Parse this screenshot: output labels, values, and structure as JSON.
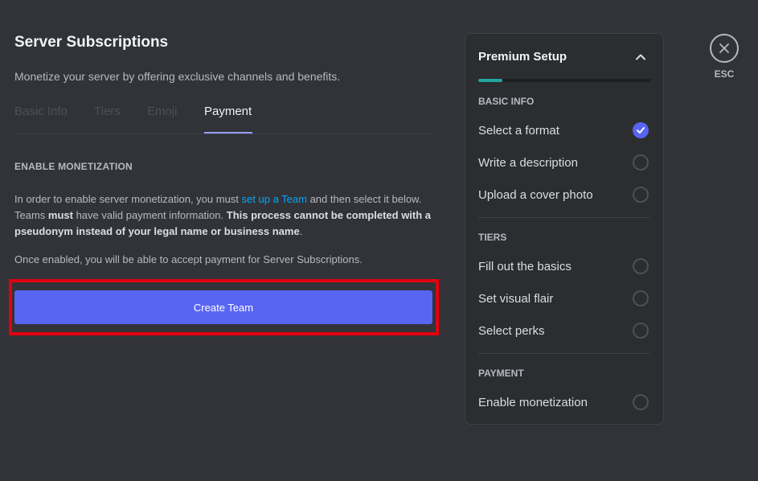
{
  "page": {
    "title": "Server Subscriptions",
    "subtitle": "Monetize your server by offering exclusive channels and benefits."
  },
  "tabs": [
    {
      "label": "Basic Info",
      "active": false
    },
    {
      "label": "Tiers",
      "active": false
    },
    {
      "label": "Emoji",
      "active": false
    },
    {
      "label": "Payment",
      "active": true
    }
  ],
  "monetization": {
    "heading": "ENABLE MONETIZATION",
    "p1_a": "In order to enable server monetization, you must ",
    "p1_link": "set up a Team",
    "p1_b": " and then select it below. Teams ",
    "p1_bold1": "must",
    "p1_c": " have valid payment information. ",
    "p1_bold2": "This process cannot be completed with a pseudonym instead of your legal name or business name",
    "p1_d": ".",
    "p2": "Once enabled, you will be able to accept payment for Server Subscriptions.",
    "button_label": "Create Team"
  },
  "checklist": {
    "title": "Premium Setup",
    "progress": 0.14,
    "groups": [
      {
        "heading": "BASIC INFO",
        "items": [
          {
            "label": "Select a format",
            "done": true
          },
          {
            "label": "Write a description",
            "done": false
          },
          {
            "label": "Upload a cover photo",
            "done": false
          }
        ]
      },
      {
        "heading": "TIERS",
        "items": [
          {
            "label": "Fill out the basics",
            "done": false
          },
          {
            "label": "Set visual flair",
            "done": false
          },
          {
            "label": "Select perks",
            "done": false
          }
        ]
      },
      {
        "heading": "PAYMENT",
        "items": [
          {
            "label": "Enable monetization",
            "done": false
          }
        ]
      }
    ]
  },
  "close": {
    "label": "ESC"
  },
  "colors": {
    "background": "#313338",
    "panel": "#2b2d31",
    "accent": "#5865f2",
    "link": "#00a8fc",
    "progress": "#23a5a0",
    "highlight": "#e3000f"
  },
  "icons": {
    "collapse": "chevron-up-icon",
    "check": "check-icon",
    "close": "close-icon"
  }
}
